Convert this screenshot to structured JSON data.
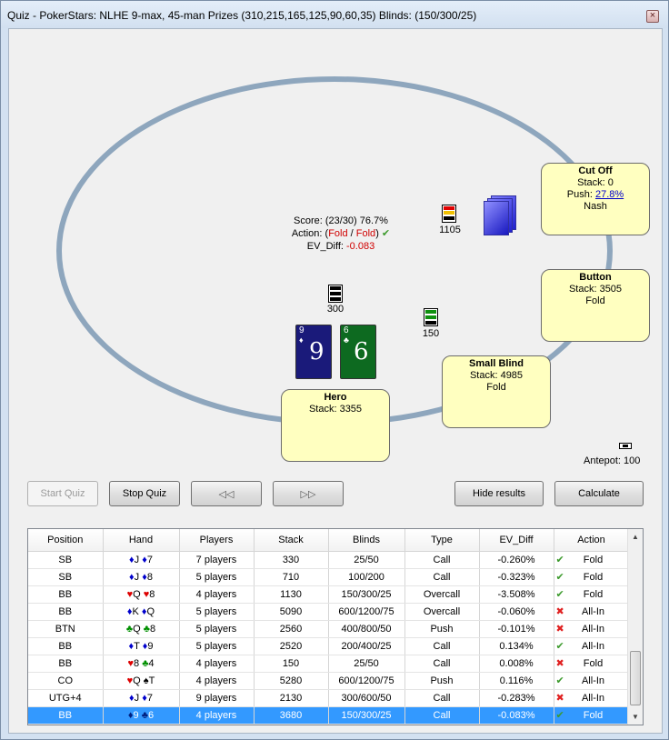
{
  "window": {
    "title": "Quiz - PokerStars: NLHE 9-max, 45-man Prizes (310,215,165,125,90,60,35) Blinds: (150/300/25)",
    "close_glyph": "×"
  },
  "seats": {
    "cutoff": {
      "name": "Cut Off",
      "stack": "Stack: 0",
      "push_prefix": "Push: ",
      "push_value": "27.8%",
      "action": "Nash"
    },
    "button": {
      "name": "Button",
      "stack": "Stack: 3505",
      "action": "Fold"
    },
    "small_blind": {
      "name": "Small Blind",
      "stack": "Stack: 4985",
      "action": "Fold"
    },
    "hero": {
      "name": "Hero",
      "stack": "Stack: 3355"
    }
  },
  "score": {
    "score_line": "Score: (23/30) 76.7%",
    "action_prefix": "Action: (",
    "action_user": "Fold",
    "action_sep": " / ",
    "action_correct": "Fold",
    "action_suffix": ")",
    "ev_prefix": "EV_Diff: ",
    "ev_value": "-0.083"
  },
  "bets": {
    "top_amount": "1105",
    "hero_amount": "300",
    "sb_amount": "150"
  },
  "hero_cards": [
    {
      "rank": "9",
      "suit": "♦",
      "color": "#1a1a7a"
    },
    {
      "rank": "6",
      "suit": "♣",
      "color": "#0d6a20"
    }
  ],
  "antepot": "Antepot: 100",
  "buttons": {
    "start_quiz": "Start Quiz",
    "stop_quiz": "Stop Quiz",
    "rewind": "◁◁",
    "forward": "▷▷",
    "hide_results": "Hide results",
    "calculate": "Calculate"
  },
  "results": {
    "columns": [
      "Position",
      "Hand",
      "Players",
      "Stack",
      "Blinds",
      "Type",
      "EV_Diff",
      "Action"
    ],
    "rows": [
      {
        "position": "SB",
        "hand": [
          [
            "♦",
            "J",
            "d"
          ],
          [
            "♦",
            "7",
            "d"
          ]
        ],
        "players": "7 players",
        "stack": "330",
        "blinds": "25/50",
        "type": "Call",
        "ev": "-0.260%",
        "ok": true,
        "action": "Fold"
      },
      {
        "position": "SB",
        "hand": [
          [
            "♦",
            "J",
            "d"
          ],
          [
            "♦",
            "8",
            "d"
          ]
        ],
        "players": "5 players",
        "stack": "710",
        "blinds": "100/200",
        "type": "Call",
        "ev": "-0.323%",
        "ok": true,
        "action": "Fold"
      },
      {
        "position": "BB",
        "hand": [
          [
            "♥",
            "Q",
            "h"
          ],
          [
            "♥",
            "8",
            "h"
          ]
        ],
        "players": "4 players",
        "stack": "1130",
        "blinds": "150/300/25",
        "type": "Overcall",
        "ev": "-3.508%",
        "ok": true,
        "action": "Fold"
      },
      {
        "position": "BB",
        "hand": [
          [
            "♦",
            "K",
            "d"
          ],
          [
            "♦",
            "Q",
            "d"
          ]
        ],
        "players": "5 players",
        "stack": "5090",
        "blinds": "600/1200/75",
        "type": "Overcall",
        "ev": "-0.060%",
        "ok": false,
        "action": "All-In"
      },
      {
        "position": "BTN",
        "hand": [
          [
            "♣",
            "Q",
            "c"
          ],
          [
            "♣",
            "8",
            "c"
          ]
        ],
        "players": "5 players",
        "stack": "2560",
        "blinds": "400/800/50",
        "type": "Push",
        "ev": "-0.101%",
        "ok": false,
        "action": "All-In"
      },
      {
        "position": "BB",
        "hand": [
          [
            "♦",
            "T",
            "d"
          ],
          [
            "♦",
            "9",
            "d"
          ]
        ],
        "players": "5 players",
        "stack": "2520",
        "blinds": "200/400/25",
        "type": "Call",
        "ev": "0.134%",
        "ok": true,
        "action": "All-In"
      },
      {
        "position": "BB",
        "hand": [
          [
            "♥",
            "8",
            "h"
          ],
          [
            "♣",
            "4",
            "c"
          ]
        ],
        "players": "4 players",
        "stack": "150",
        "blinds": "25/50",
        "type": "Call",
        "ev": "0.008%",
        "ok": false,
        "action": "Fold"
      },
      {
        "position": "CO",
        "hand": [
          [
            "♥",
            "Q",
            "h"
          ],
          [
            "♠",
            "T",
            "s"
          ]
        ],
        "players": "4 players",
        "stack": "5280",
        "blinds": "600/1200/75",
        "type": "Push",
        "ev": "0.116%",
        "ok": true,
        "action": "All-In"
      },
      {
        "position": "UTG+4",
        "hand": [
          [
            "♦",
            "J",
            "d"
          ],
          [
            "♦",
            "7",
            "d"
          ]
        ],
        "players": "9 players",
        "stack": "2130",
        "blinds": "300/600/50",
        "type": "Call",
        "ev": "-0.283%",
        "ok": false,
        "action": "All-In"
      },
      {
        "position": "BB",
        "hand": [
          [
            "♦",
            "9",
            "d"
          ],
          [
            "♣",
            "6",
            "c"
          ]
        ],
        "players": "4 players",
        "stack": "3680",
        "blinds": "150/300/25",
        "type": "Call",
        "ev": "-0.083%",
        "ok": true,
        "action": "Fold"
      }
    ],
    "selected_index": 9
  },
  "icons": {
    "check": "✔",
    "cross": "✖",
    "scroll_up": "▲",
    "scroll_down": "▼"
  }
}
